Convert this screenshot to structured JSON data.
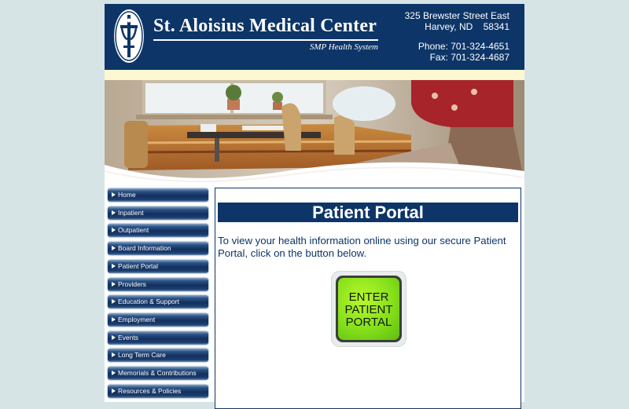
{
  "header": {
    "title": "St. Aloisius Medical Center",
    "subtitle": "SMP Health System",
    "address_street": "325 Brewster Street East",
    "address_city": "Harvey, ND    58341",
    "phone": "Phone: 701-324-4651",
    "fax": "Fax: 701-324-4687",
    "logo_icon": "cross-logo-icon"
  },
  "nav": {
    "items": [
      {
        "label": "Home"
      },
      {
        "label": "Inpatient"
      },
      {
        "label": "Outpatient"
      },
      {
        "label": "Board Information"
      },
      {
        "label": "Patient Portal"
      },
      {
        "label": "Providers"
      },
      {
        "label": "Education & Support"
      },
      {
        "label": "Employment"
      },
      {
        "label": "Events"
      },
      {
        "label": "Long Term Care"
      },
      {
        "label": "Memorials & Contributions"
      },
      {
        "label": "Resources & Policies"
      }
    ],
    "arrow_icon": "triangle-right-icon"
  },
  "main": {
    "title": "Patient Portal",
    "text": "To view your health information online using our secure Patient Portal, click on the button below.",
    "button_label": "ENTER PATIENT PORTAL"
  },
  "colors": {
    "brand_navy": "#0d3567",
    "page_background": "#d6e4e6",
    "cream_band": "#fdf8d2",
    "button_green": "#86e01b"
  }
}
